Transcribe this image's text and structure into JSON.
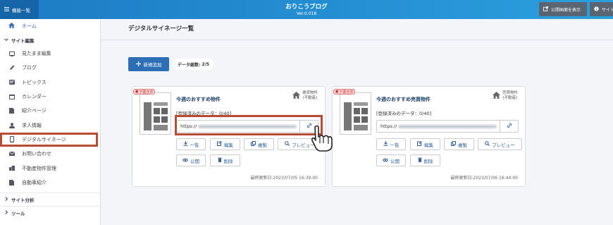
{
  "header": {
    "menu_label": "機能一覧",
    "site_title": "おりこうブログ",
    "version": "Ver.0.018",
    "public_btn": "公開画面を表示",
    "site_btn": "サイト"
  },
  "sidebar": {
    "home": "ホーム",
    "sections": [
      {
        "label": "サイト編集",
        "expanded": true
      },
      {
        "label": "サイト分析",
        "expanded": false
      },
      {
        "label": "ツール",
        "expanded": false
      }
    ],
    "items": [
      {
        "label": "見たまま編集",
        "icon": "monitor-icon"
      },
      {
        "label": "ブログ",
        "icon": "pencil-icon"
      },
      {
        "label": "トピックス",
        "icon": "topics-icon"
      },
      {
        "label": "カレンダー",
        "icon": "calendar-icon"
      },
      {
        "label": "紹介ページ",
        "icon": "page-icon"
      },
      {
        "label": "求人情報",
        "icon": "person-icon"
      },
      {
        "label": "デジタルサイネージ",
        "icon": "tablet-icon",
        "active": true
      },
      {
        "label": "お問い合わせ",
        "icon": "envelope-icon"
      },
      {
        "label": "不動産物件管理",
        "icon": "building-icon"
      },
      {
        "label": "自動車紹介",
        "icon": "car-icon"
      }
    ]
  },
  "main": {
    "title": "デジタルサイネージ一覧",
    "add_btn": "新規追加",
    "count_label": "データ総数:",
    "count_value": "2/5"
  },
  "cards": [
    {
      "draft": "下書き中",
      "title": "今週のおすすめ物件",
      "category_line1": "賃貸物件",
      "category_line2": "(不動産)",
      "registered": "[登録済みのデータ：0/40]",
      "url_prefix": "https://",
      "buttons": {
        "list": "一覧",
        "edit": "編集",
        "copy": "複製",
        "preview": "プレビュー",
        "publish": "公開",
        "delete": "削除"
      },
      "updated": "最終更新日:2023/07/05 16:39:00"
    },
    {
      "draft": "下書き中",
      "title": "今週のおすすめ売買物件",
      "category_line1": "売買物件",
      "category_line2": "(不動産)",
      "registered": "[登録済みのデータ：0/40]",
      "url_prefix": "https://",
      "buttons": {
        "list": "一覧",
        "edit": "編集",
        "copy": "複製",
        "preview": "プレビュー",
        "publish": "公開",
        "delete": "削除"
      },
      "updated": "最終更新日:2023/07/06 16:44:00"
    }
  ],
  "colors": {
    "accent": "#2d6fb7",
    "highlight": "#b94a34",
    "draft": "#cc3333"
  }
}
